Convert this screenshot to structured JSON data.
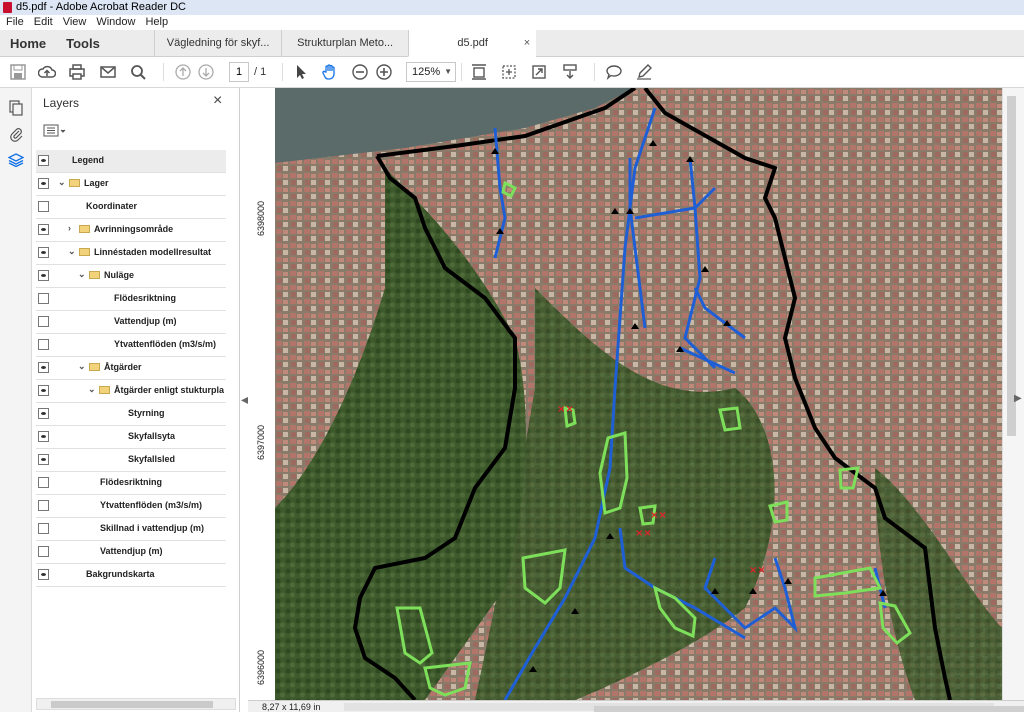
{
  "window": {
    "title": "d5.pdf - Adobe Acrobat Reader DC"
  },
  "menu": [
    "File",
    "Edit",
    "View",
    "Window",
    "Help"
  ],
  "tabs": {
    "home": "Home",
    "tools": "Tools",
    "documents": [
      "Vägledning för skyf...",
      "Strukturplan Meto...",
      "d5.pdf"
    ],
    "close": "×"
  },
  "toolbar": {
    "page_current": "1",
    "page_total": "/ 1",
    "zoom": "125%"
  },
  "layers_panel": {
    "title": "Layers",
    "close": "×",
    "rows": [
      {
        "label": "Legend",
        "eye": true,
        "expander": false,
        "folder": false
      },
      {
        "label": "Lager",
        "eye": true,
        "expander": true,
        "folder": true
      },
      {
        "label": "Koordinater",
        "eye": false,
        "expander": false,
        "folder": false
      },
      {
        "label": "Avrinningsområde",
        "eye": true,
        "expander": true,
        "folder": true
      },
      {
        "label": "Linnéstaden modellresultat",
        "eye": true,
        "expander": true,
        "folder": true
      },
      {
        "label": "Nuläge",
        "eye": true,
        "expander": true,
        "folder": true
      },
      {
        "label": "Flödesriktning",
        "eye": false,
        "expander": false,
        "folder": false
      },
      {
        "label": "Vattendjup (m)",
        "eye": false,
        "expander": false,
        "folder": false
      },
      {
        "label": "Ytvattenflöden (m3/s/m)",
        "eye": false,
        "expander": false,
        "folder": false
      },
      {
        "label": "Åtgärder",
        "eye": true,
        "expander": true,
        "folder": true
      },
      {
        "label": "Åtgärder enligt stukturplan I",
        "eye": true,
        "expander": true,
        "folder": true
      },
      {
        "label": "Styrning",
        "eye": true,
        "expander": false,
        "folder": false
      },
      {
        "label": "Skyfallsyta",
        "eye": true,
        "expander": false,
        "folder": false
      },
      {
        "label": "Skyfallsled",
        "eye": true,
        "expander": false,
        "folder": false
      },
      {
        "label": "Flödesriktning",
        "eye": false,
        "expander": false,
        "folder": false
      },
      {
        "label": "Ytvattenflöden (m3/s/m)",
        "eye": false,
        "expander": false,
        "folder": false
      },
      {
        "label": "Skillnad i vattendjup (m)",
        "eye": false,
        "expander": false,
        "folder": false
      },
      {
        "label": "Vattendjup (m)",
        "eye": false,
        "expander": false,
        "folder": false
      },
      {
        "label": "Bakgrundskarta",
        "eye": true,
        "expander": false,
        "folder": false
      }
    ]
  },
  "map": {
    "y_coordinates": [
      "6398000",
      "6397000",
      "6396000"
    ],
    "colors": {
      "boundary": "#000000",
      "flow_route": "#1f5fd6",
      "surface": "#7ee05a",
      "marker": "#e0242a",
      "water": "#5a6b6a",
      "vegetation": "#3e5a2c",
      "urban": "#b3746a"
    }
  },
  "status": {
    "page_size": "8,27 x 11,69 in"
  }
}
